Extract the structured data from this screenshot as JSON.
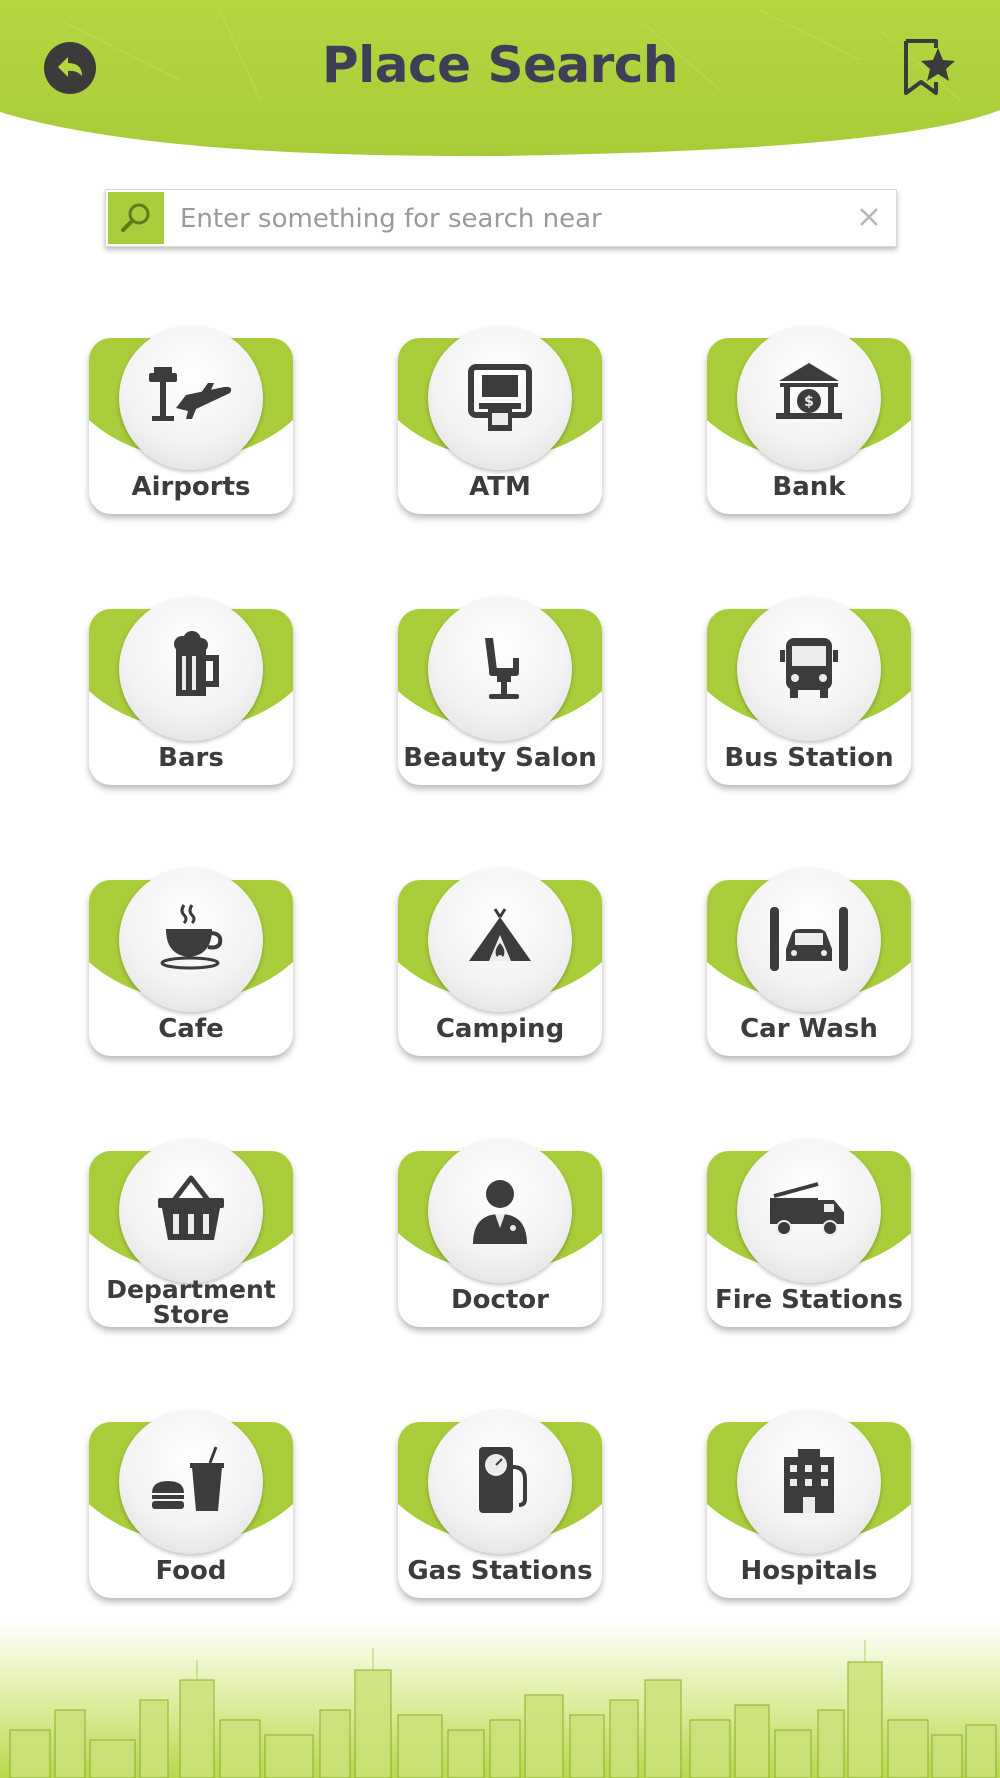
{
  "header": {
    "title": "Place Search",
    "back_icon": "back-arrow-icon",
    "favorites_icon": "bookmark-star-icon"
  },
  "search": {
    "placeholder": "Enter something for search near",
    "value": "",
    "search_icon": "search-icon",
    "clear_icon": "close-icon"
  },
  "categories": [
    {
      "label": "Airports",
      "icon": "airport-icon"
    },
    {
      "label": "ATM",
      "icon": "atm-icon"
    },
    {
      "label": "Bank",
      "icon": "bank-icon"
    },
    {
      "label": "Bars",
      "icon": "beer-mug-icon"
    },
    {
      "label": "Beauty Salon",
      "icon": "salon-chair-icon"
    },
    {
      "label": "Bus Station",
      "icon": "bus-icon"
    },
    {
      "label": "Cafe",
      "icon": "coffee-cup-icon"
    },
    {
      "label": "Camping",
      "icon": "tent-icon"
    },
    {
      "label": "Car Wash",
      "icon": "car-wash-icon"
    },
    {
      "label": "Department Store",
      "icon": "basket-icon"
    },
    {
      "label": "Doctor",
      "icon": "doctor-icon"
    },
    {
      "label": "Fire Stations",
      "icon": "fire-truck-icon"
    },
    {
      "label": "Food",
      "icon": "fast-food-icon"
    },
    {
      "label": "Gas Stations",
      "icon": "fuel-pump-icon"
    },
    {
      "label": "Hospitals",
      "icon": "hospital-building-icon"
    }
  ],
  "colors": {
    "accent": "#a9cd3a",
    "title": "#3e3f57",
    "icon": "#3b3d3a"
  }
}
